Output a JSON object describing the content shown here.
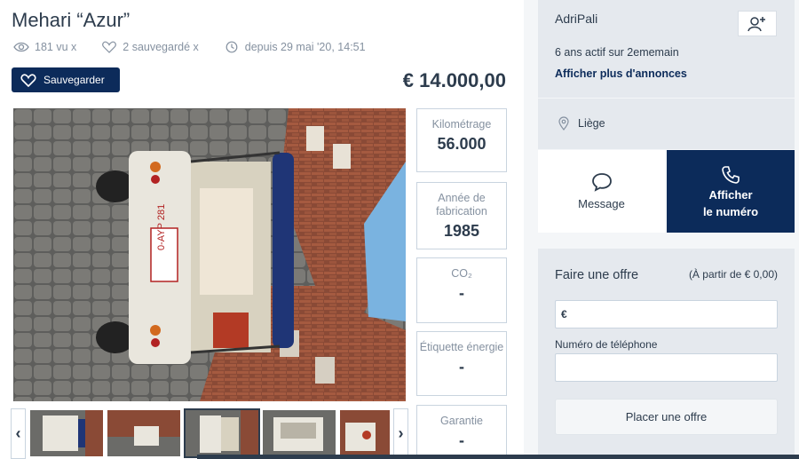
{
  "listing": {
    "title": "Mehari “Azur”",
    "views": "181 vu x",
    "saved": "2 sauvegardé x",
    "since": "depuis 29 mai '20, 14:51",
    "save_label": "Sauvegarder",
    "price": "€ 14.000,00"
  },
  "specs": [
    {
      "label": "Kilométrage",
      "value": "56.000"
    },
    {
      "label": "Année de fabrication",
      "value": "1985"
    },
    {
      "label": "CO₂",
      "value": "-"
    },
    {
      "label": "Étiquette énergie",
      "value": "-"
    },
    {
      "label": "Garantie",
      "value": "-"
    }
  ],
  "gallery": {
    "prev_icon": "‹",
    "next_icon": "›",
    "plate_text": "0-AYP 281"
  },
  "seller": {
    "name": "AdriPali",
    "active": "6 ans actif sur 2ememain",
    "more_ads": "Afficher plus d'annonces",
    "location": "Liège"
  },
  "contact": {
    "message_label": "Message",
    "call_label_1": "Afficher",
    "call_label_2": "le numéro"
  },
  "offer": {
    "title": "Faire une offre",
    "min": "(À partir de € 0,00)",
    "currency": "€",
    "phone_label": "Numéro de téléphone",
    "submit_label": "Placer une offre"
  },
  "colors": {
    "primary": "#0c2b5a",
    "text": "#2d3c4d",
    "muted": "#8591a0",
    "panel": "#e5e9ee"
  }
}
